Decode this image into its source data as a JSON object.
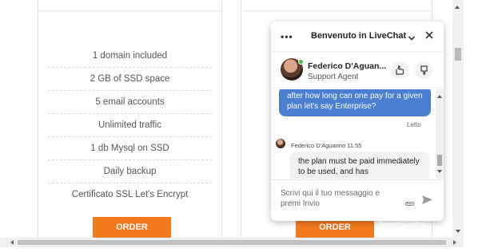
{
  "plans": [
    {
      "features": [
        "1 domain included",
        "2 GB of SSD space",
        "5 email accounts",
        "Unlimited traffic",
        "1 db Mysql on SSD",
        "Daily backup",
        "Certificato SSL Let's Encrypt"
      ],
      "order_label": "ORDER"
    },
    {
      "features": [],
      "order_label": "ORDER"
    }
  ],
  "chat": {
    "menu_label": "•••",
    "title": "Benvenuto in LiveChat",
    "agent": {
      "name": "Federico D'Aguan...",
      "role": "Support Agent",
      "status_color": "#4cba3c"
    },
    "messages": {
      "visitor": "after how long can one pay for a given plan let's say Enterprise?",
      "read_status": "Letto",
      "agent_meta": "Federico D'Aguanno 11:55",
      "agent": "the plan must be paid immediately to be used, and has"
    },
    "input_placeholder": "Scrivi qui il tuo messaggio e premi Invio",
    "powered_by": "Powered by LiveChat"
  },
  "colors": {
    "accent_orange": "#f47a20",
    "visitor_bubble": "#4a7fd1"
  },
  "icons": [
    "dots-menu-icon",
    "chevron-down-icon",
    "close-icon",
    "thumbs-up-icon",
    "thumbs-down-icon",
    "paperclip-icon",
    "send-icon"
  ]
}
